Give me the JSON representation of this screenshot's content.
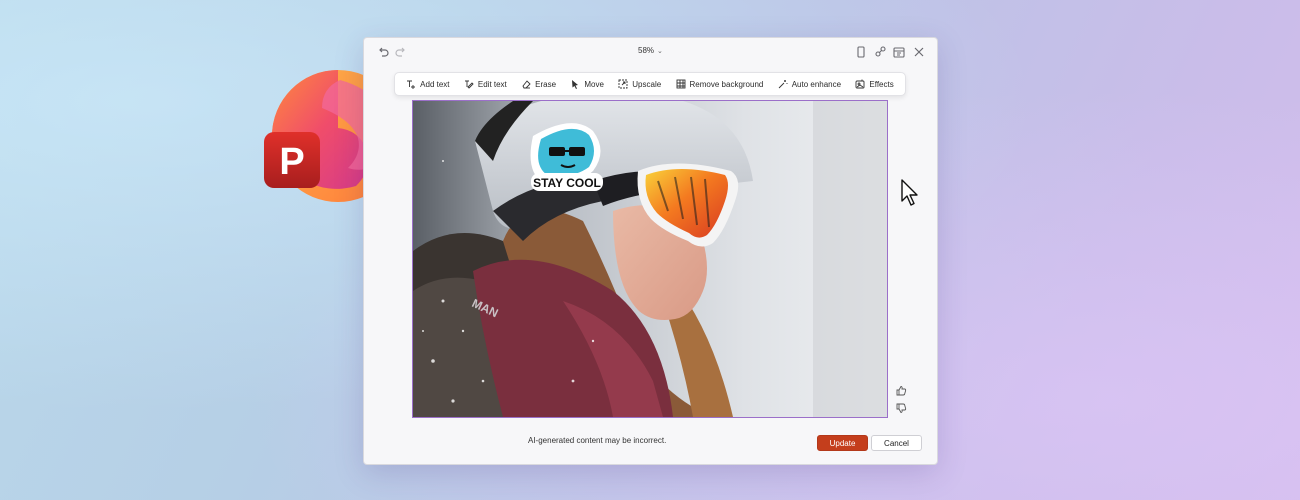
{
  "dialog": {
    "zoom_level": "58%",
    "toolbar": {
      "add_text": "Add text",
      "edit_text": "Edit text",
      "erase": "Erase",
      "move": "Move",
      "upscale": "Upscale",
      "remove_background": "Remove background",
      "auto_enhance": "Auto enhance",
      "effects": "Effects"
    },
    "image": {
      "sticker_text": "STAY COOL",
      "scarf_text": "MAN"
    },
    "ai_disclaimer": "AI-generated content may be incorrect.",
    "update_label": "Update",
    "cancel_label": "Cancel"
  },
  "logo": {
    "letter": "P"
  },
  "colors": {
    "accent": "#c43e1c",
    "image_border": "#9b6fc9",
    "sticker": "#3fbcd8"
  },
  "icons": [
    "undo-icon",
    "redo-icon",
    "copy-icon",
    "share-icon",
    "calendar-icon",
    "close-icon",
    "thumbs-up-icon",
    "thumbs-down-icon",
    "cursor-icon"
  ]
}
